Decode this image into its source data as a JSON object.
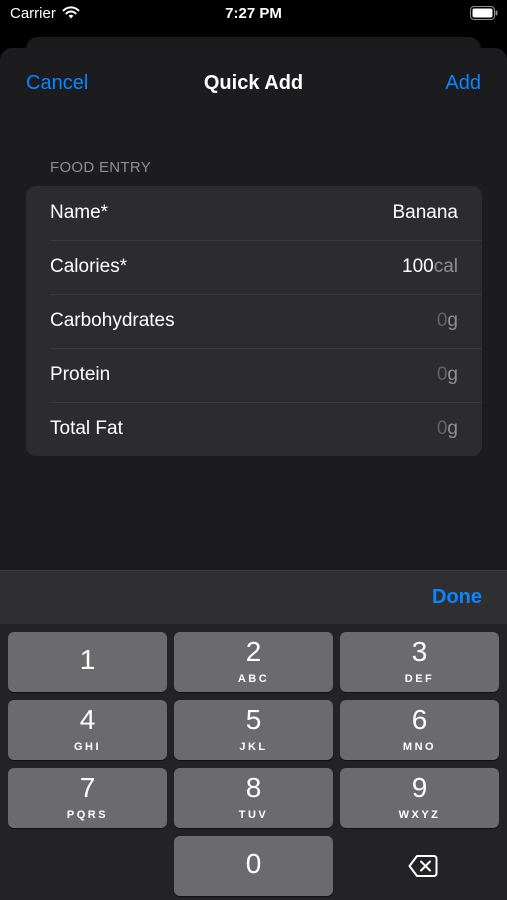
{
  "status_bar": {
    "carrier": "Carrier",
    "time": "7:27 PM"
  },
  "nav": {
    "cancel_label": "Cancel",
    "title": "Quick Add",
    "add_label": "Add"
  },
  "form": {
    "section_header": "FOOD ENTRY",
    "rows": [
      {
        "label": "Name*",
        "value": "Banana",
        "unit": ""
      },
      {
        "label": "Calories*",
        "value": "100",
        "unit": "cal"
      },
      {
        "label": "Carbohydrates",
        "placeholder": "0",
        "unit": "g"
      },
      {
        "label": "Protein",
        "placeholder": "0",
        "unit": "g"
      },
      {
        "label": "Total Fat",
        "placeholder": "0",
        "unit": "g"
      }
    ]
  },
  "keyboard": {
    "done_label": "Done",
    "keys": [
      {
        "digit": "1",
        "letters": ""
      },
      {
        "digit": "2",
        "letters": "ABC"
      },
      {
        "digit": "3",
        "letters": "DEF"
      },
      {
        "digit": "4",
        "letters": "GHI"
      },
      {
        "digit": "5",
        "letters": "JKL"
      },
      {
        "digit": "6",
        "letters": "MNO"
      },
      {
        "digit": "7",
        "letters": "PQRS"
      },
      {
        "digit": "8",
        "letters": "TUV"
      },
      {
        "digit": "9",
        "letters": "WXYZ"
      },
      {
        "digit": "0",
        "letters": ""
      }
    ]
  },
  "icons": {
    "wifi": "wifi-icon",
    "battery": "battery-icon",
    "delete": "delete-backspace-icon"
  },
  "colors": {
    "accent": "#0a84ff",
    "sheet_background": "#1c1c1e",
    "group_background": "#2c2c2e",
    "key_background": "#6b6b6e"
  }
}
